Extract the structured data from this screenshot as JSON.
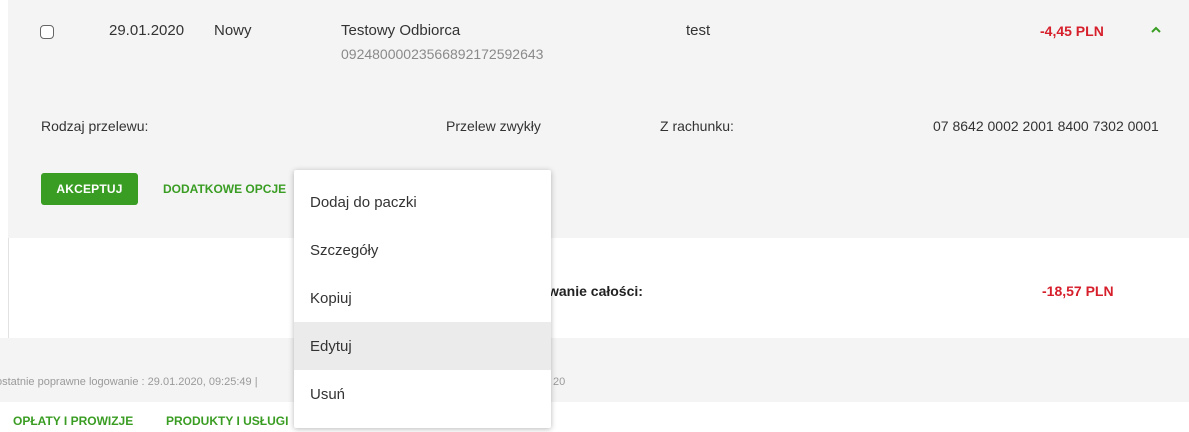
{
  "transaction": {
    "date": "29.01.2020",
    "status": "Nowy",
    "recipient_name": "Testowy Odbiorca",
    "recipient_account": "09248000023566892172592643",
    "title": "test",
    "amount": "-4,45 PLN"
  },
  "details": {
    "transfer_type_label": "Rodzaj przelewu:",
    "transfer_type_value": "Przelew zwykły",
    "from_account_label": "Z rachunku:",
    "from_account_value": "07 8642 0002 2001 8400 7302 0001"
  },
  "actions": {
    "accept_label": "AKCEPTUJ",
    "more_options_label": "DODATKOWE OPCJE"
  },
  "menu": {
    "items": [
      "Dodaj do paczki",
      "Szczegóły",
      "Kopiuj",
      "Edytuj",
      "Usuń"
    ]
  },
  "total": {
    "label_partial": "wanie całości:",
    "amount": "-18,57 PLN"
  },
  "footer": {
    "last_login_partial": "ostatnie poprawne logowanie : 29.01.2020, 09:25:49  |",
    "date_partial": "20",
    "fees_link": "OPŁATY I PROWIZJE",
    "products_link": "PRODUKTY I USŁUGI"
  },
  "colors": {
    "accent_green": "#3a9d23",
    "amount_red": "#d61f2b",
    "row_gray": "#f4f4f4"
  }
}
